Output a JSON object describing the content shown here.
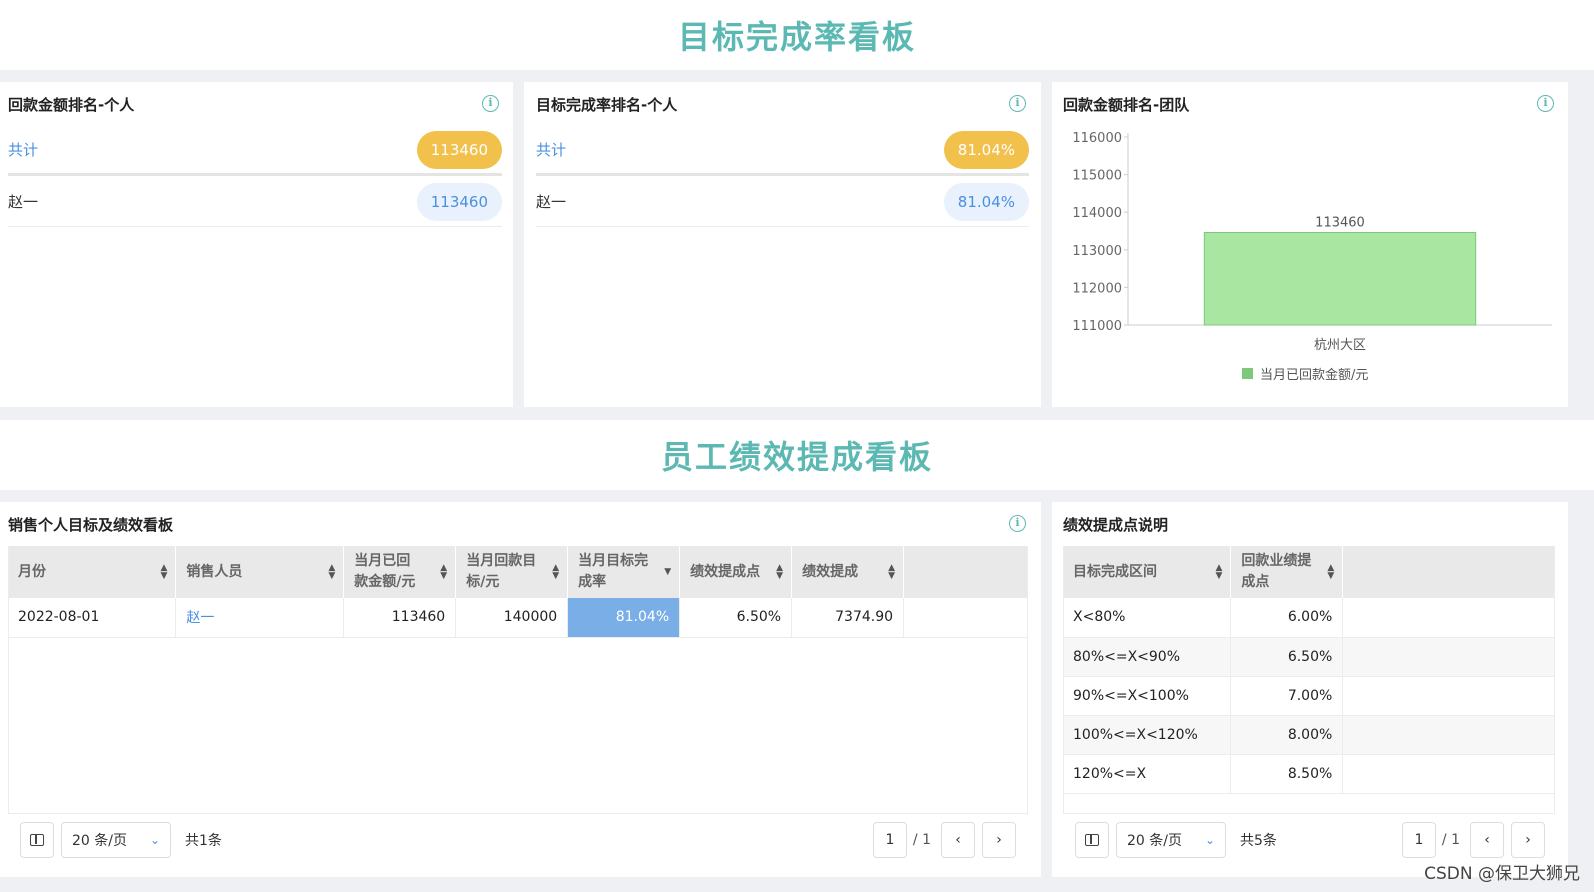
{
  "titles": {
    "board1": "目标完成率看板",
    "board2": "员工绩效提成看板"
  },
  "card1": {
    "title": "回款金额排名-个人",
    "total_label": "共计",
    "total_value": "113460",
    "rows": [
      {
        "name": "赵一",
        "value": "113460"
      }
    ]
  },
  "card2": {
    "title": "目标完成率排名-个人",
    "total_label": "共计",
    "total_value": "81.04%",
    "rows": [
      {
        "name": "赵一",
        "value": "81.04%"
      }
    ]
  },
  "card3": {
    "title": "回款金额排名-团队"
  },
  "chart_data": {
    "type": "bar",
    "categories": [
      "杭州大区"
    ],
    "series": [
      {
        "name": "当月已回款金额/元",
        "values": [
          113460
        ]
      }
    ],
    "data_labels": [
      "113460"
    ],
    "yticks": [
      "116000",
      "115000",
      "114000",
      "113000",
      "112000",
      "111000"
    ],
    "ylim": [
      111000,
      116000
    ],
    "legend_position": "bottom",
    "bar_color": "#a8e6a1",
    "bar_edge_color": "#7cc97a"
  },
  "perf": {
    "title": "销售个人目标及绩效看板",
    "headers": [
      "月份",
      "销售人员",
      "当月已回款金额/元",
      "当月回款目标/元",
      "当月目标完成率",
      "绩效提成点",
      "绩效提成"
    ],
    "header_lines": [
      [
        "月份"
      ],
      [
        "销售人员"
      ],
      [
        "当月已回",
        "款金额/元"
      ],
      [
        "当月回款目",
        "标/元"
      ],
      [
        "当月目标完",
        "成率"
      ],
      [
        "绩效提成点"
      ],
      [
        "绩效提成"
      ]
    ],
    "rows": [
      {
        "month": "2022-08-01",
        "person": "赵一",
        "received": "113460",
        "target": "140000",
        "rate": "81.04%",
        "point": "6.50%",
        "commission": "7374.90"
      }
    ],
    "page_size": "20 条/页",
    "total": "共1条",
    "page": "1",
    "pages": "/ 1"
  },
  "rules": {
    "title": "绩效提成点说明",
    "headers": [
      "目标完成区间",
      "回款业绩提成点"
    ],
    "header_lines": [
      [
        "目标完成区间"
      ],
      [
        "回款业绩提",
        "成点"
      ]
    ],
    "rows": [
      {
        "range": "X<80%",
        "point": "6.00%"
      },
      {
        "range": "80%<=X<90%",
        "point": "6.50%"
      },
      {
        "range": "90%<=X<100%",
        "point": "7.00%"
      },
      {
        "range": "100%<=X<120%",
        "point": "8.00%"
      },
      {
        "range": "120%<=X",
        "point": "8.50%"
      }
    ],
    "page_size": "20 条/页",
    "total": "共5条",
    "page": "1",
    "pages": "/ 1"
  },
  "watermark": "CSDN @保卫大狮兄",
  "colors": {
    "accent_teal": "#5cb8b2",
    "gold": "#f2c14c",
    "link_blue": "#4a90e2",
    "highlight_blue": "#7aaee6"
  }
}
